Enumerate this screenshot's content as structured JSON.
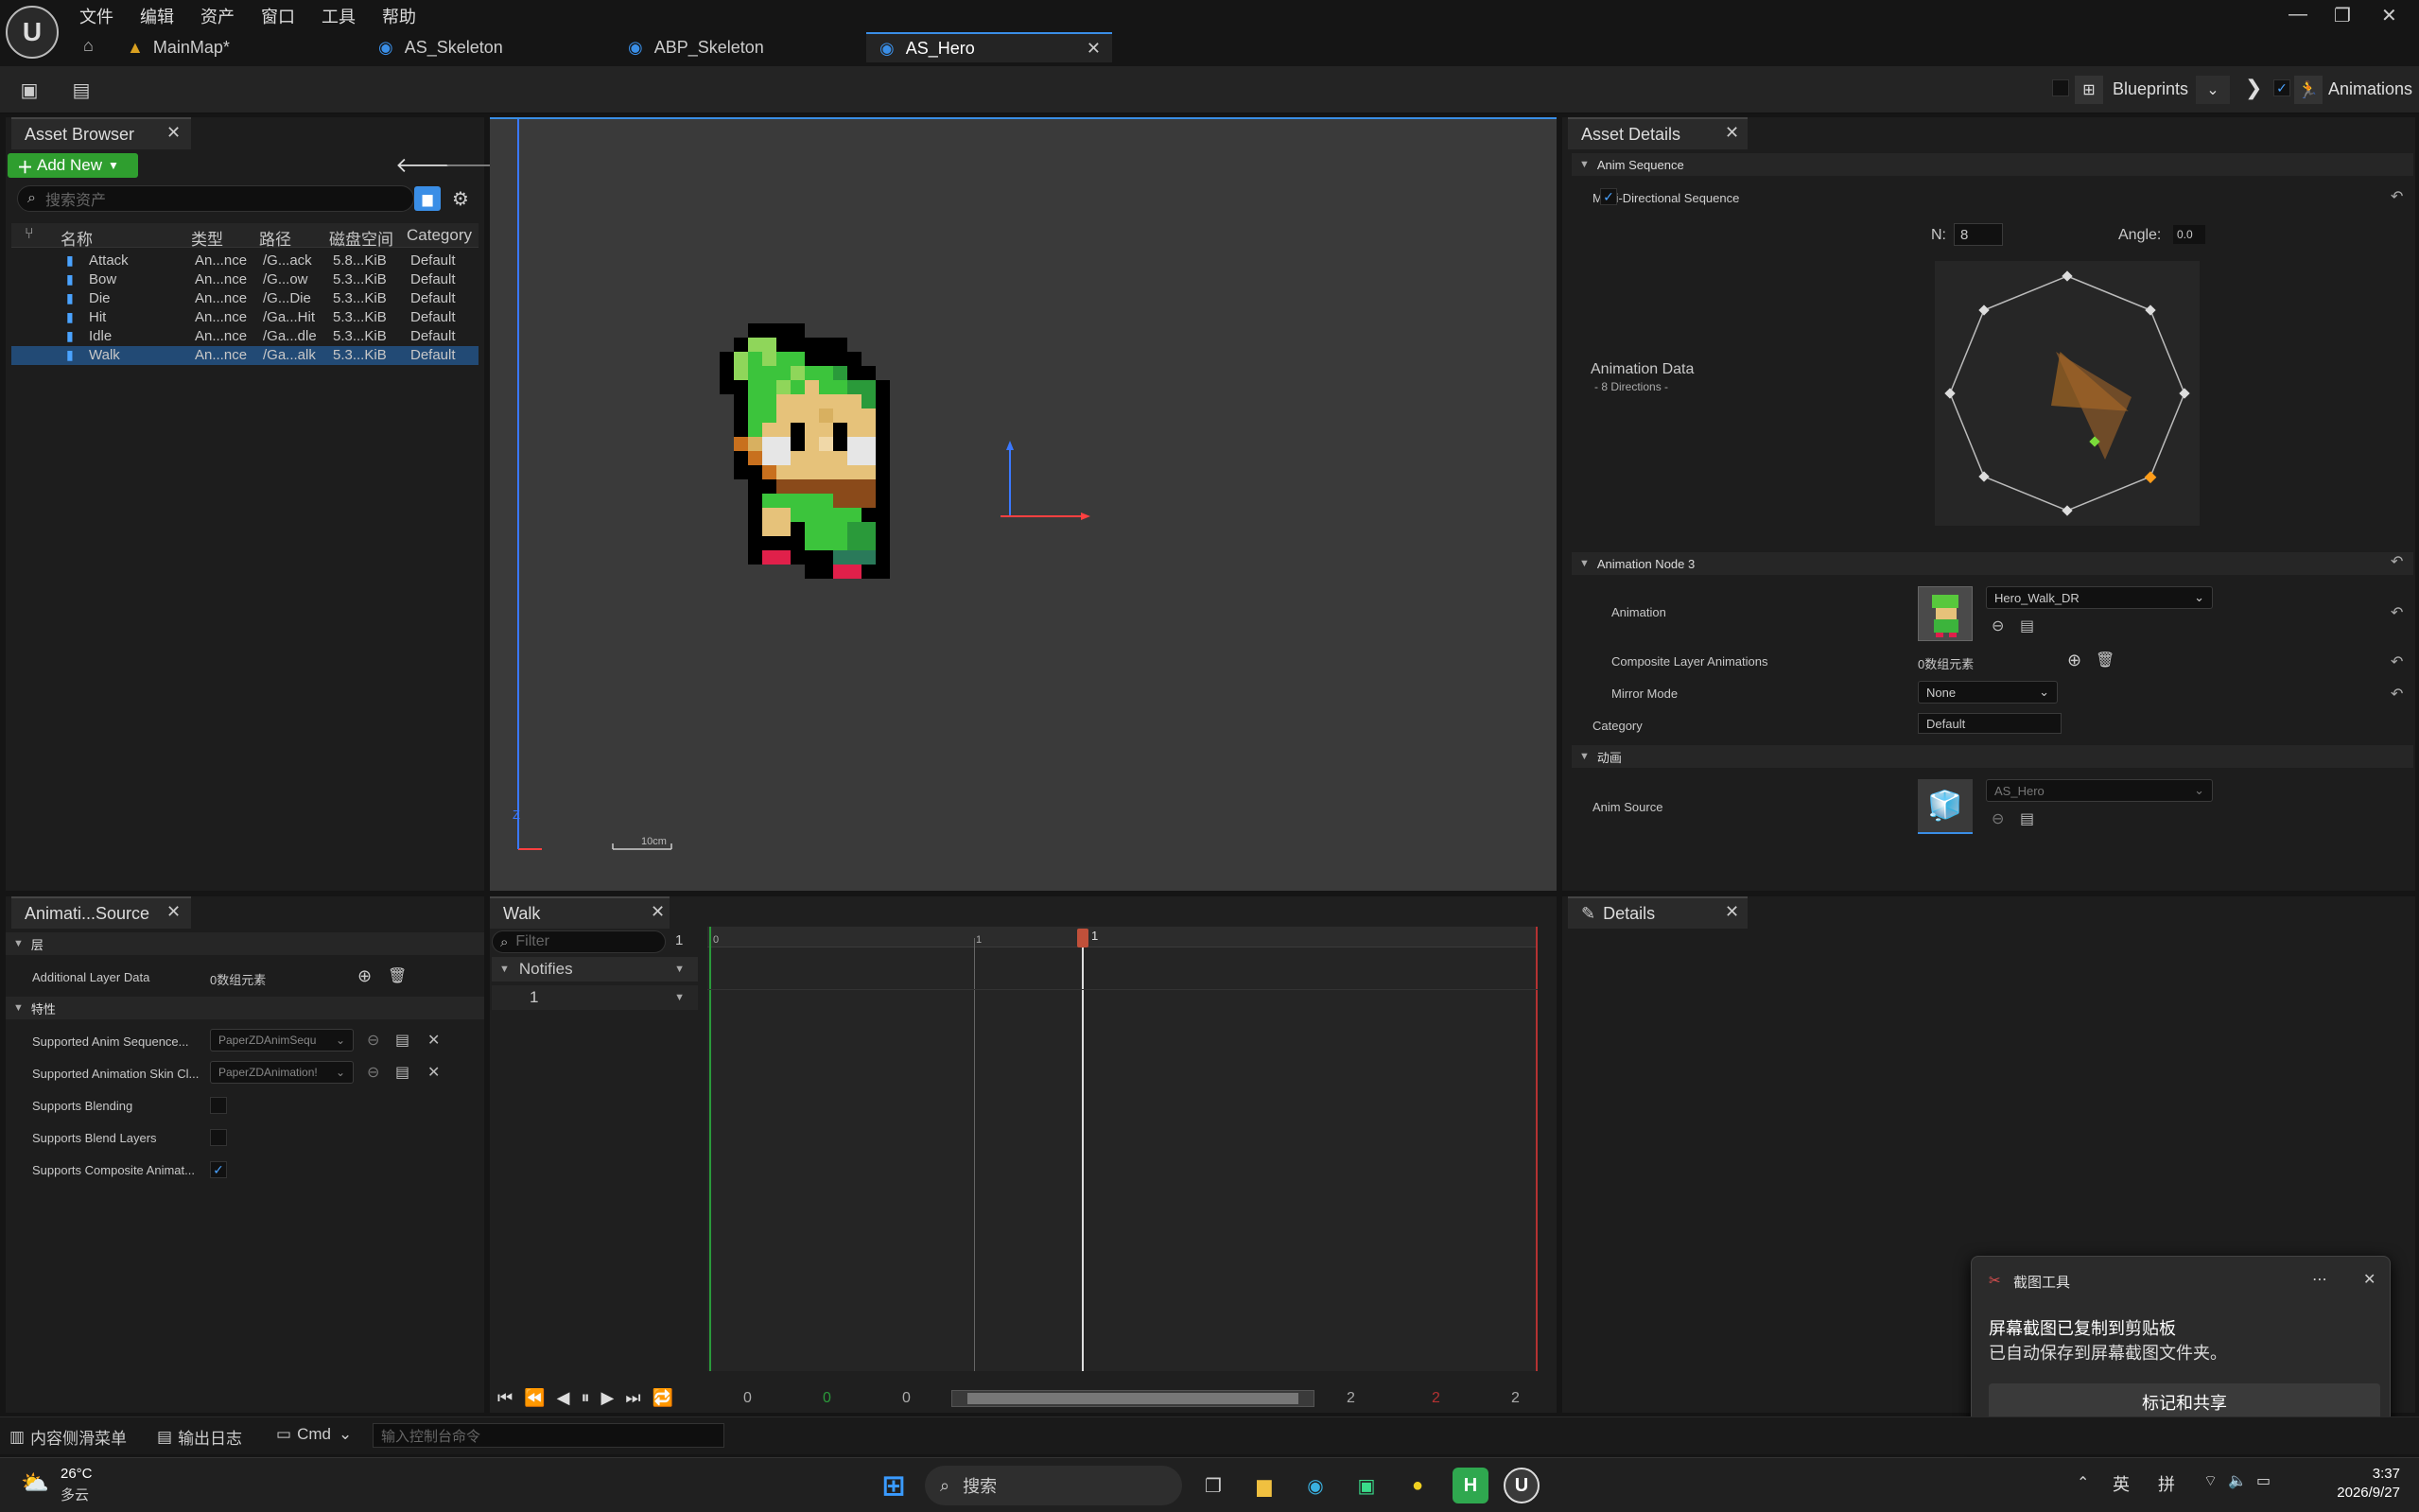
{
  "menu": [
    "文件",
    "编辑",
    "资产",
    "窗口",
    "工具",
    "帮助"
  ],
  "tabs": [
    {
      "label": "MainMap*"
    },
    {
      "label": "AS_Skeleton"
    },
    {
      "label": "ABP_Skeleton"
    },
    {
      "label": "AS_Hero"
    }
  ],
  "toolbar": {
    "blueprints": "Blueprints",
    "animations": "Animations"
  },
  "asset_browser": {
    "title": "Asset Browser",
    "add_new": "Add New",
    "search_placeholder": "搜索资产",
    "columns": [
      "名称",
      "类型",
      "路径",
      "磁盘空间",
      "Category"
    ],
    "rows": [
      {
        "name": "Attack",
        "type": "An...nce",
        "path": "/G...ack",
        "size": "5.8...KiB",
        "category": "Default"
      },
      {
        "name": "Bow",
        "type": "An...nce",
        "path": "/G...ow",
        "size": "5.3...KiB",
        "category": "Default"
      },
      {
        "name": "Die",
        "type": "An...nce",
        "path": "/G...Die",
        "size": "5.3...KiB",
        "category": "Default"
      },
      {
        "name": "Hit",
        "type": "An...nce",
        "path": "/Ga...Hit",
        "size": "5.3...KiB",
        "category": "Default"
      },
      {
        "name": "Idle",
        "type": "An...nce",
        "path": "/Ga...dle",
        "size": "5.3...KiB",
        "category": "Default"
      },
      {
        "name": "Walk",
        "type": "An...nce",
        "path": "/Ga...alk",
        "size": "5.3...KiB",
        "category": "Default"
      }
    ],
    "selected_index": 5
  },
  "viewport": {
    "axis_z": "Z",
    "scale": "10cm"
  },
  "asset_details": {
    "title": "Asset Details",
    "section_anim_sequence": "Anim Sequence",
    "multi_dir_label": "Multi-Directional Sequence",
    "n_label": "N:",
    "n_value": "8",
    "angle_label": "Angle:",
    "angle_value": "0.0",
    "anim_data_label": "Animation Data",
    "anim_data_sub": "- 8 Directions -",
    "section_node": "Animation Node 3",
    "animation_label": "Animation",
    "animation_value": "Hero_Walk_DR",
    "composite_label": "Composite Layer Animations",
    "composite_value": "0数组元素",
    "mirror_label": "Mirror Mode",
    "mirror_value": "None",
    "category_label": "Category",
    "category_value": "Default",
    "section_anim": "动画",
    "anim_source_label": "Anim Source",
    "anim_source_value": "AS_Hero"
  },
  "anim_source": {
    "title": "Animati...Source",
    "section_layer": "层",
    "additional_layer_label": "Additional Layer Data",
    "additional_layer_value": "0数组元素",
    "section_props": "特性",
    "supported_seq_label": "Supported Anim Sequence...",
    "supported_seq_value": "PaperZDAnimSequ",
    "supported_skin_label": "Supported Animation Skin Cl...",
    "supported_skin_value": "PaperZDAnimation!",
    "blending_label": "Supports Blending",
    "blend_layers_label": "Supports Blend Layers",
    "composite_label": "Supports Composite Animat..."
  },
  "timeline": {
    "title": "Walk",
    "filter_placeholder": "Filter",
    "filter_count": "1",
    "notifies": "Notifies",
    "track": "1",
    "ruler_start": "0",
    "ruler_mid": "1",
    "playhead_label": "1",
    "bottom_left": [
      "0",
      "0",
      "0"
    ],
    "bottom_right": [
      "2",
      "2",
      "2"
    ]
  },
  "details": {
    "title": "Details"
  },
  "notification": {
    "app": "截图工具",
    "line1": "屏幕截图已复制到剪贴板",
    "line2": "已自动保存到屏幕截图文件夹。",
    "button": "标记和共享"
  },
  "statusbar": {
    "content_drawer": "内容侧滑菜单",
    "output_log": "输出日志",
    "cmd": "Cmd",
    "console_placeholder": "输入控制台命令"
  },
  "taskbar": {
    "temp": "26°C",
    "weather": "多云",
    "search": "搜索",
    "ime1": "英",
    "ime2": "拼",
    "time": "3:37",
    "date": "2026/9/27"
  },
  "colors": {
    "accent": "#3a8ee6",
    "green_btn": "#2f9e2f",
    "timeline_green": "#2a9a3a",
    "timeline_red": "#b43232"
  }
}
